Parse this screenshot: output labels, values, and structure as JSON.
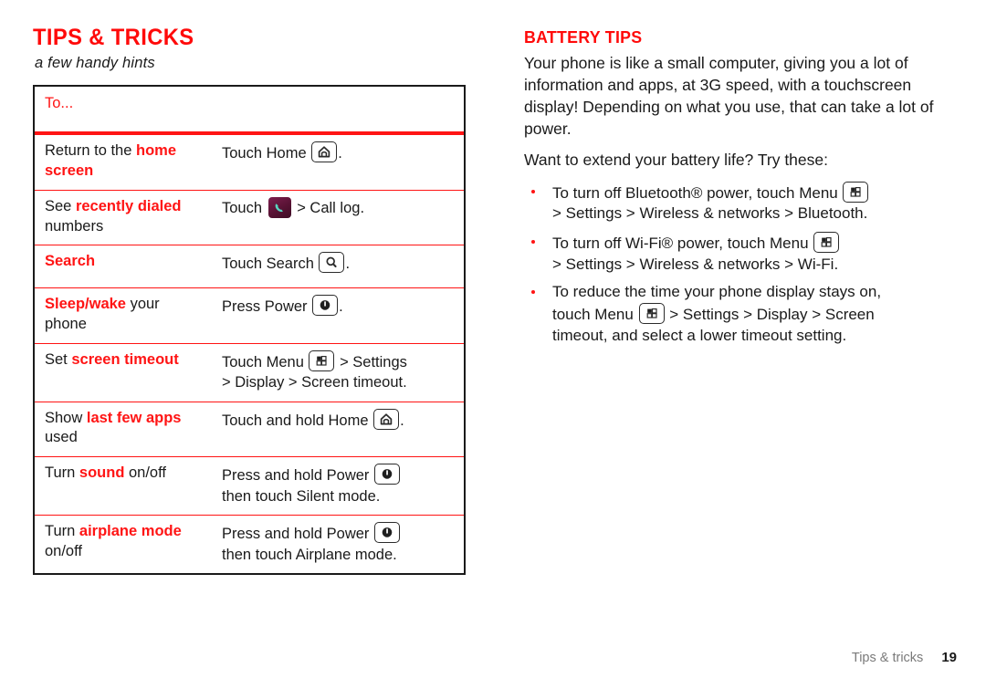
{
  "left": {
    "title": "TIPS & TRICKS",
    "subtitle": "a few handy hints",
    "table": {
      "header": "To...",
      "rows": [
        {
          "action_pre": "Return to the ",
          "action_em": "home",
          "action_post": "",
          "action_line2": "screen",
          "action_line2_emphasis": true,
          "do_pre": "Touch Home ",
          "do_icon": "home-icon",
          "do_post": ".",
          "do_line2": ""
        },
        {
          "action_pre": "See ",
          "action_em": "recently dialed",
          "action_post": "",
          "action_line2": "numbers",
          "action_line2_emphasis": false,
          "do_pre": "Touch ",
          "do_icon": "phone-app-icon",
          "do_post": " > Call log.",
          "do_line2": ""
        },
        {
          "action_pre": "",
          "action_em": "Search",
          "action_post": "",
          "action_line2": "",
          "action_line2_emphasis": false,
          "do_pre": "Touch Search ",
          "do_icon": "search-icon",
          "do_post": ".",
          "do_line2": ""
        },
        {
          "action_pre": "",
          "action_em": "Sleep/wake",
          "action_post": " your",
          "action_line2": "phone",
          "action_line2_emphasis": false,
          "do_pre": "Press Power ",
          "do_icon": "power-icon",
          "do_post": ".",
          "do_line2": ""
        },
        {
          "action_pre": "Set ",
          "action_em": "screen timeout",
          "action_post": "",
          "action_line2": "",
          "action_line2_emphasis": false,
          "do_pre": "Touch Menu ",
          "do_icon": "menu-icon",
          "do_post": " > Settings",
          "do_line2": "> Display > Screen timeout."
        },
        {
          "action_pre": "Show ",
          "action_em": "last few apps",
          "action_post": "",
          "action_line2": "used",
          "action_line2_emphasis": false,
          "do_pre": "Touch and hold Home ",
          "do_icon": "home-icon",
          "do_post": ".",
          "do_line2": ""
        },
        {
          "action_pre": "Turn ",
          "action_em": "sound",
          "action_post": " on/off",
          "action_line2": "",
          "action_line2_emphasis": false,
          "do_pre": "Press and hold Power ",
          "do_icon": "power-icon",
          "do_post": "",
          "do_line2": "then touch Silent mode."
        },
        {
          "action_pre": "Turn ",
          "action_em": "airplane mode",
          "action_post": "",
          "action_line2": "on/off",
          "action_line2_emphasis": false,
          "do_pre": "Press and hold Power ",
          "do_icon": "power-icon",
          "do_post": "",
          "do_line2": "then touch Airplane mode."
        }
      ]
    }
  },
  "right": {
    "title": "BATTERY TIPS",
    "paragraph1": "Your phone is like a small computer, giving you a lot of information and apps, at 3G speed, with a touchscreen display! Depending on what you use, that can take a lot of power.",
    "paragraph2": "Want to extend your battery life? Try these:",
    "bullets": [
      {
        "pre": "To turn off Bluetooth® power, touch Menu ",
        "icon": "menu-icon",
        "post": "",
        "line2": "> Settings > Wireless & networks > Bluetooth.",
        "line3": ""
      },
      {
        "pre": "To turn off Wi-Fi® power, touch Menu ",
        "icon": "menu-icon",
        "post": "",
        "line2": "> Settings > Wireless & networks > Wi-Fi.",
        "line3": ""
      },
      {
        "pre": "To reduce the time your phone display stays on,",
        "icon": "",
        "post": "",
        "line2_pre": "touch Menu ",
        "line2_icon": "menu-icon",
        "line2_post": " > Settings > Display > Screen",
        "line3": "timeout, and select a lower timeout setting."
      }
    ]
  },
  "footer": {
    "section": "Tips & tricks",
    "page": "19"
  },
  "colors": {
    "accent_red": "#ff1414",
    "title_red": "#ff0a0a",
    "text": "#1a1a1a",
    "footer_gray": "#7a7a7a"
  }
}
